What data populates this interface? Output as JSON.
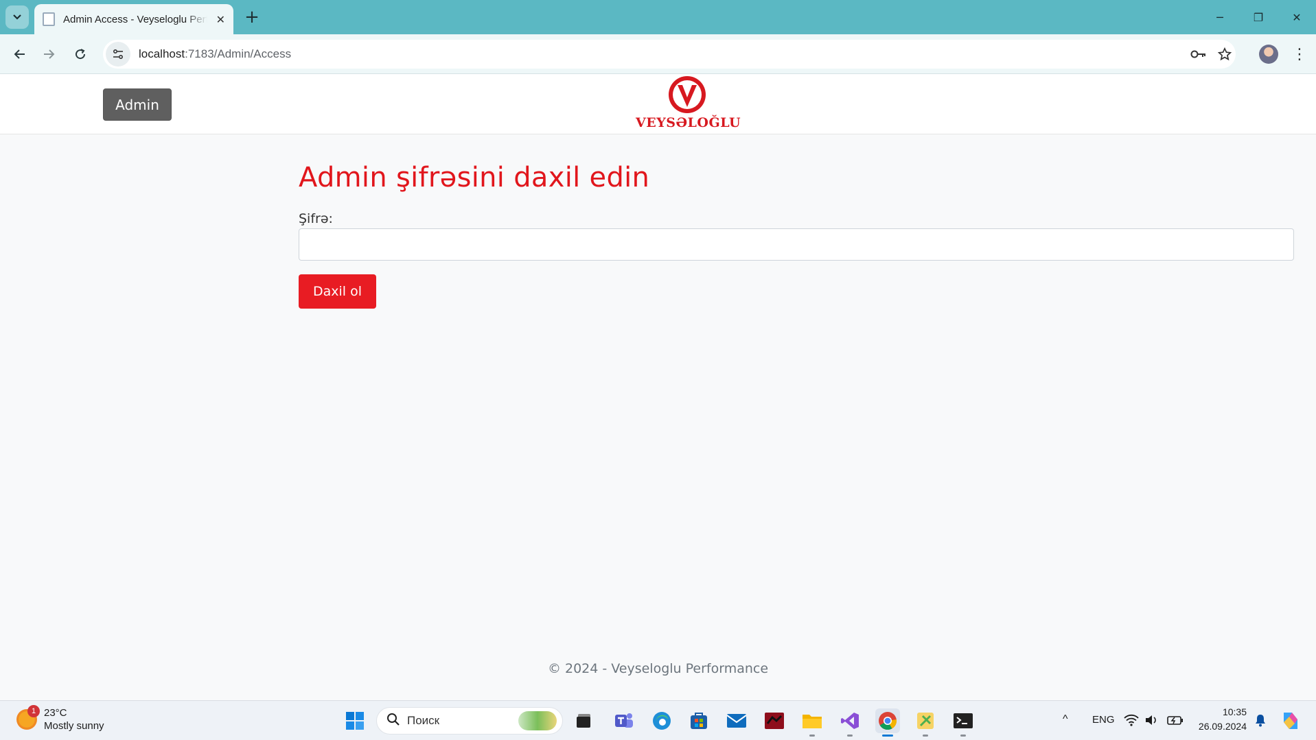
{
  "browser": {
    "tab_title": "Admin Access - Veyseloglu Perf",
    "tab_close": "✕",
    "new_tab": "+",
    "url_host": "localhost",
    "url_rest": ":7183/Admin/Access",
    "window_controls": [
      "─",
      "❐",
      "✕"
    ]
  },
  "header": {
    "admin_button": "Admin",
    "logo_text": "VEYSƏLOĞLU"
  },
  "form": {
    "heading": "Admin şifrəsini daxil edin",
    "password_label": "Şifrə:",
    "password_value": "",
    "submit_label": "Daxil ol"
  },
  "footer": {
    "text": "© 2024 - Veyseloglu Performance"
  },
  "taskbar": {
    "weather_badge": "1",
    "temperature": "23°C",
    "weather_desc": "Mostly sunny",
    "search_placeholder": "Поиск",
    "language": "ENG",
    "time": "10:35",
    "date": "26.09.2024"
  },
  "colors": {
    "brand_red": "#e1161c",
    "tab_bar": "#5bb8c3",
    "admin_button_bg": "#5f5f5f"
  }
}
